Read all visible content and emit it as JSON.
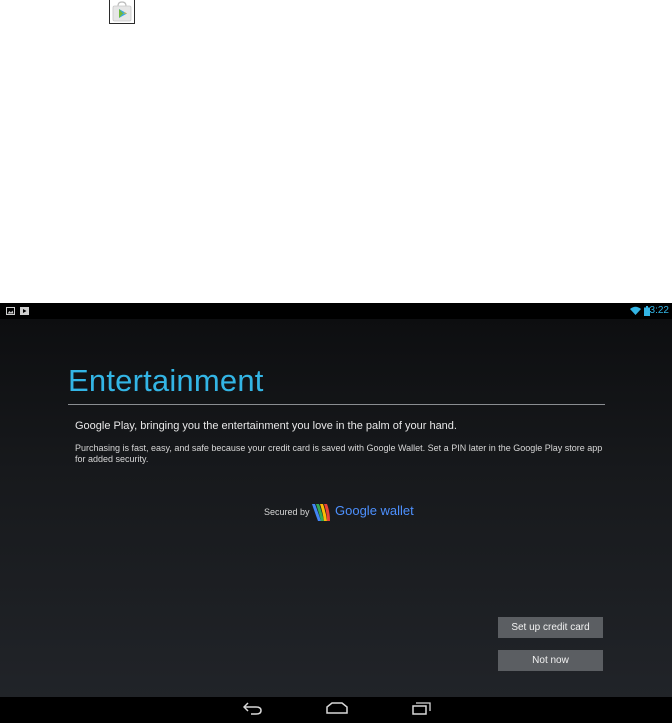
{
  "app_icon": {
    "name": "google-play-icon"
  },
  "status_bar": {
    "left_icons": [
      "gallery-icon",
      "play-store-icon"
    ],
    "right_icons": [
      "wifi-icon",
      "battery-icon"
    ],
    "time": "3:22",
    "accent": "#33b5e5"
  },
  "page": {
    "title": "Entertainment",
    "lead": "Google Play, bringing you the entertainment you love in the palm of your hand.",
    "body": "Purchasing is fast, easy, and safe because your credit card is saved with Google Wallet. Set a PIN later in the Google Play store app for added security."
  },
  "secured": {
    "label": "Secured by",
    "brand": "Google wallet",
    "brand_color": "#4d90fe"
  },
  "buttons": {
    "setup": "Set up credit card",
    "not_now": "Not now"
  },
  "nav_bar": {
    "icons": [
      "back-icon",
      "home-icon",
      "recent-apps-icon"
    ]
  }
}
